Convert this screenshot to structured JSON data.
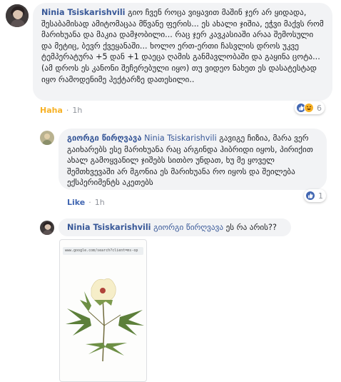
{
  "comments": [
    {
      "author": "Ninia Tsiskarishvili",
      "text": "გიო ჩვენ როცა ვიყავით მაშინ ჯერ არ ყიდადა, შესაბამისად ამიტომაცაა მწვანე ფერის... ეს ახალი ჯიშია, ეჭვი მაქვს რომ მარიხუანა და მაკია დამჯობილი... რაც ჯერ კავკასიაში არაა შემოსული და მეტიც, ბევრ ქვეყანაში... ხოლო ერთ-ერთი ჩასვლის დროს უკვე ტემპერატურა +5 დან +1 დაეცა ღამის განმავლობაში და გაყინა ცოტა...(ამ დროს ეს კანონი შეჩერებული იყო) თუ ვიდეო ნახეთ ეს დასატესტად იყო რამოდენიმე ჰექტარზე დათესილი..",
      "actions": {
        "haha": "Haha",
        "time": "1h"
      },
      "reactions": {
        "count": "6",
        "icons": [
          "like-icon",
          "haha-icon"
        ]
      }
    },
    {
      "author": "გიორგი წირღვავა",
      "mention": "Ninia Tsiskarishvili",
      "text": "გავიგე ჩიზია, მარა ვერ გაიხარებს ესე მარიხუანა რაც არგინდა ჰიბრიდი იყოს, პირიქით ახალ გამოყვანილ ჯიშებს სითბო უნდათ, ხუ მე ყოველ შემთხვევაში არ მგონია ეს მარიხუანა რო იყოს და შეილება ექსპერიმენტს აკეთებს",
      "actions": {
        "like": "Like",
        "time": "1h"
      },
      "reactions": {
        "count": "1",
        "icons": [
          "like-icon"
        ]
      }
    },
    {
      "author": "Ninia Tsiskarishvili",
      "mention": "გიორგი წირღვავა",
      "text": "ეს რა არის??",
      "attachment": {
        "url": "www.google.com/search?client=ms-op"
      }
    }
  ],
  "colors": {
    "link": "#385898",
    "bubble": "#f2f3f5",
    "action": "#4267b2",
    "meta": "#90949c"
  }
}
